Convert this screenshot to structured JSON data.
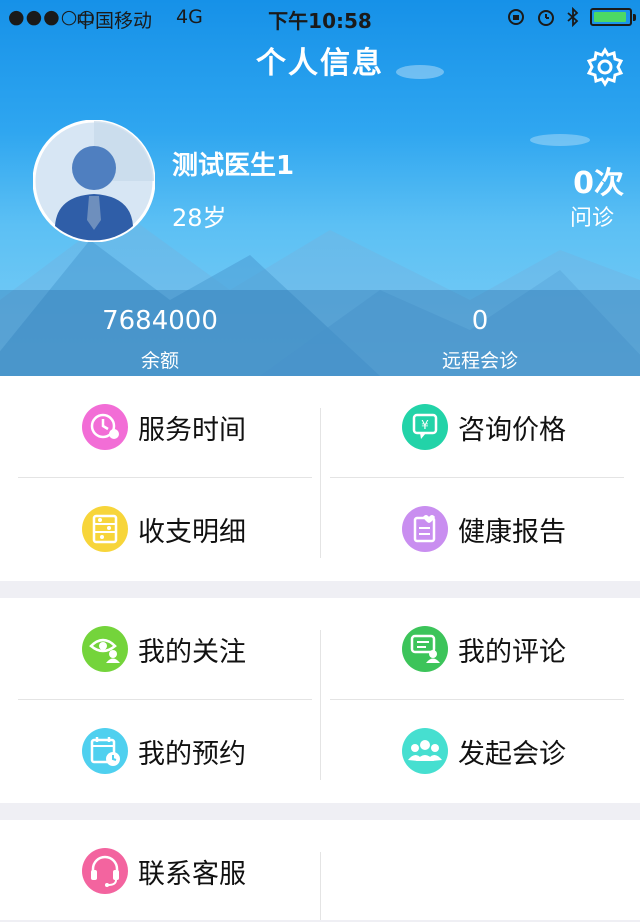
{
  "status_bar": {
    "signal": "●●●○○",
    "carrier": "中国移动",
    "network": "4G",
    "time": "下午10:58",
    "battery_level": 0.9
  },
  "header": {
    "title": "个人信息",
    "settings_icon": "gear-icon"
  },
  "profile": {
    "name": "测试医生1",
    "age": "28岁",
    "consult_count": "0次",
    "consult_label": "问诊"
  },
  "stats": {
    "balance_value": "7684000",
    "balance_label": "余额",
    "remote_value": "0",
    "remote_label": "远程会诊"
  },
  "menu": {
    "service_time": "服务时间",
    "consult_price": "咨询价格",
    "income_detail": "收支明细",
    "health_report": "健康报告",
    "my_follow": "我的关注",
    "my_comment": "我的评论",
    "my_appointment": "我的预约",
    "start_consult": "发起会诊",
    "contact_service": "联系客服"
  },
  "colors": {
    "header_top": "#1691e8",
    "icon_pink": "#f26dd6",
    "icon_teal": "#22d3a8",
    "icon_yellow": "#f7d53a",
    "icon_purple": "#c98ef0",
    "icon_green": "#74d43b",
    "icon_green2": "#3cc45a",
    "icon_cyan": "#4fd0ef",
    "icon_aqua": "#46dfd0",
    "icon_rose": "#f3649f"
  }
}
